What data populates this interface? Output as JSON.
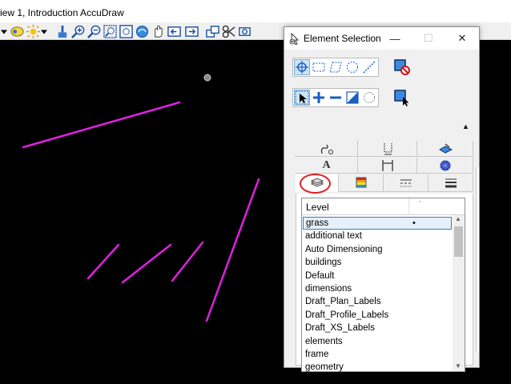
{
  "view": {
    "title": "iew 1, Introduction AccuDraw",
    "background": "#000000",
    "element_color": "#e020e0"
  },
  "toolbar": {
    "icons": [
      "dropdown-arrow-icon",
      "view-display-icon",
      "lights-icon",
      "brush-icon",
      "zoom-in-icon",
      "zoom-out-icon",
      "window-area-icon",
      "fit-view-icon",
      "rotate-view-icon",
      "pan-icon",
      "previous-view-icon",
      "next-view-icon",
      "copy-view-icon",
      "clip-icon",
      "camera-icon"
    ]
  },
  "dialog": {
    "title": "Element Selection",
    "window_buttons": {
      "minimize": "—",
      "maximize": "☐",
      "close": "✕"
    },
    "method_tools": [
      "individual",
      "block",
      "shape",
      "circle",
      "line"
    ],
    "mode_tools": [
      "pointer",
      "add",
      "subtract",
      "invert",
      "clear"
    ],
    "expander": "▲",
    "tabs_row1": [
      "curve-icon",
      "dimension-icon",
      "display-style-icon"
    ],
    "tabs_row2": [
      "A",
      "width-icon",
      "color-icon"
    ],
    "tabs_row3": [
      "level-icon",
      "color-icon",
      "line-style-icon",
      "weight-icon"
    ],
    "active_tab": "level-icon",
    "list": {
      "header": "Level",
      "sort_glyph": "ˇ",
      "selected_marker": "•",
      "items": [
        "grass",
        "additional text",
        "Auto Dimensioning",
        "buildings",
        "Default",
        "dimensions",
        "Draft_Plan_Labels",
        "Draft_Profile_Labels",
        "Draft_XS_Labels",
        "elements",
        "frame",
        "geometry"
      ],
      "selected_index": 0
    }
  }
}
